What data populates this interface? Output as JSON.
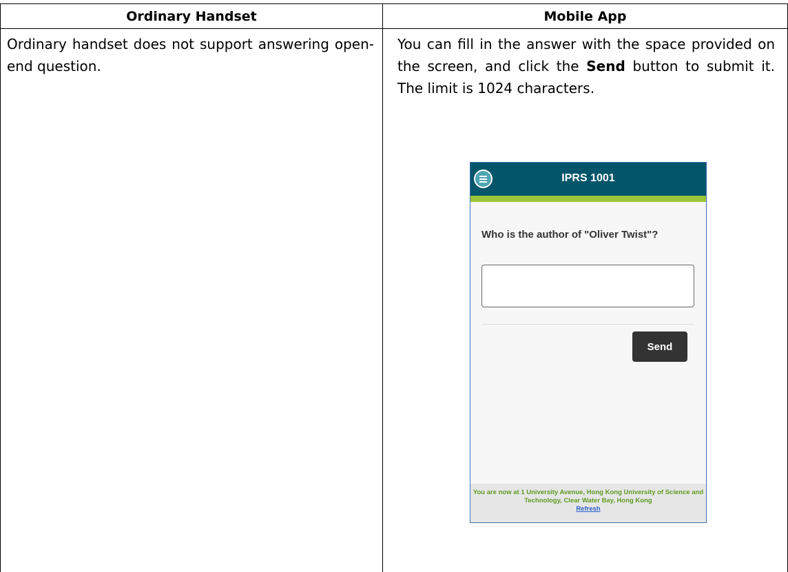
{
  "table": {
    "headers": [
      "Ordinary Handset",
      "Mobile App"
    ],
    "left_text": "Ordinary handset does not support answering open-end question.",
    "right_text_before": "You can fill in the answer with the space provided on the screen, and click the ",
    "right_text_bold": "Send",
    "right_text_after": " button to submit it. The limit is 1024 characters."
  },
  "phone": {
    "title": "IPRS 1001",
    "question": "Who is the author of \"Oliver Twist\"?",
    "answer_value": "",
    "send_label": "Send",
    "footer_text": "You are now at 1 University Avenue, Hong Kong University of Science and Technology, Clear Water Bay, Hong Kong",
    "refresh_label": "Refresh",
    "colors": {
      "header_bg": "#03556a",
      "accent_bar": "#9dc53a",
      "button_bg": "#333333",
      "footer_text": "#5e9a1f"
    },
    "icons": {
      "menu": "menu-icon"
    }
  }
}
